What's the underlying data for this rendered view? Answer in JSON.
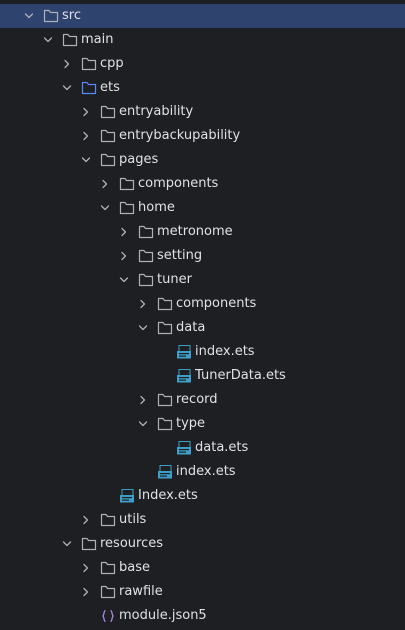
{
  "tree": {
    "colors": {
      "background": "#1e1f22",
      "selected_row": "#2e436e",
      "text": "#dfe1e5",
      "folder_icon": "#aeb1b7",
      "source_folder_icon": "#548af7",
      "ets_file_icon": "#3d9fc8",
      "json_icon": "#b286e8"
    },
    "nodes": [
      {
        "label": "src",
        "depth": 0,
        "kind": "folder",
        "expanded": true,
        "selected": true,
        "icon": "folder-icon"
      },
      {
        "label": "main",
        "depth": 1,
        "kind": "folder",
        "expanded": true,
        "icon": "folder-icon"
      },
      {
        "label": "cpp",
        "depth": 2,
        "kind": "folder",
        "expanded": false,
        "icon": "folder-icon"
      },
      {
        "label": "ets",
        "depth": 2,
        "kind": "folder",
        "expanded": true,
        "icon": "source-folder-icon"
      },
      {
        "label": "entryability",
        "depth": 3,
        "kind": "folder",
        "expanded": false,
        "icon": "folder-icon"
      },
      {
        "label": "entrybackupability",
        "depth": 3,
        "kind": "folder",
        "expanded": false,
        "icon": "folder-icon"
      },
      {
        "label": "pages",
        "depth": 3,
        "kind": "folder",
        "expanded": true,
        "icon": "folder-icon"
      },
      {
        "label": "components",
        "depth": 4,
        "kind": "folder",
        "expanded": false,
        "icon": "folder-icon"
      },
      {
        "label": "home",
        "depth": 4,
        "kind": "folder",
        "expanded": true,
        "icon": "folder-icon"
      },
      {
        "label": "metronome",
        "depth": 5,
        "kind": "folder",
        "expanded": false,
        "icon": "folder-icon"
      },
      {
        "label": "setting",
        "depth": 5,
        "kind": "folder",
        "expanded": false,
        "icon": "folder-icon"
      },
      {
        "label": "tuner",
        "depth": 5,
        "kind": "folder",
        "expanded": true,
        "icon": "folder-icon"
      },
      {
        "label": "components",
        "depth": 6,
        "kind": "folder",
        "expanded": false,
        "icon": "folder-icon"
      },
      {
        "label": "data",
        "depth": 6,
        "kind": "folder",
        "expanded": true,
        "icon": "folder-icon"
      },
      {
        "label": "index.ets",
        "depth": 7,
        "kind": "ets",
        "icon": "ets-file-icon"
      },
      {
        "label": "TunerData.ets",
        "depth": 7,
        "kind": "ets",
        "icon": "ets-file-icon"
      },
      {
        "label": "record",
        "depth": 6,
        "kind": "folder",
        "expanded": false,
        "icon": "folder-icon"
      },
      {
        "label": "type",
        "depth": 6,
        "kind": "folder",
        "expanded": true,
        "icon": "folder-icon"
      },
      {
        "label": "data.ets",
        "depth": 7,
        "kind": "ets",
        "icon": "ets-file-icon"
      },
      {
        "label": "index.ets",
        "depth": 6,
        "kind": "ets",
        "icon": "ets-file-icon"
      },
      {
        "label": "Index.ets",
        "depth": 4,
        "kind": "ets",
        "icon": "ets-file-icon"
      },
      {
        "label": "utils",
        "depth": 3,
        "kind": "folder",
        "expanded": false,
        "icon": "folder-icon"
      },
      {
        "label": "resources",
        "depth": 2,
        "kind": "folder",
        "expanded": true,
        "icon": "folder-icon"
      },
      {
        "label": "base",
        "depth": 3,
        "kind": "folder",
        "expanded": false,
        "icon": "folder-icon"
      },
      {
        "label": "rawfile",
        "depth": 3,
        "kind": "folder",
        "expanded": false,
        "icon": "folder-icon"
      },
      {
        "label": "module.json5",
        "depth": 3,
        "kind": "json",
        "icon": "json-file-icon"
      }
    ]
  }
}
